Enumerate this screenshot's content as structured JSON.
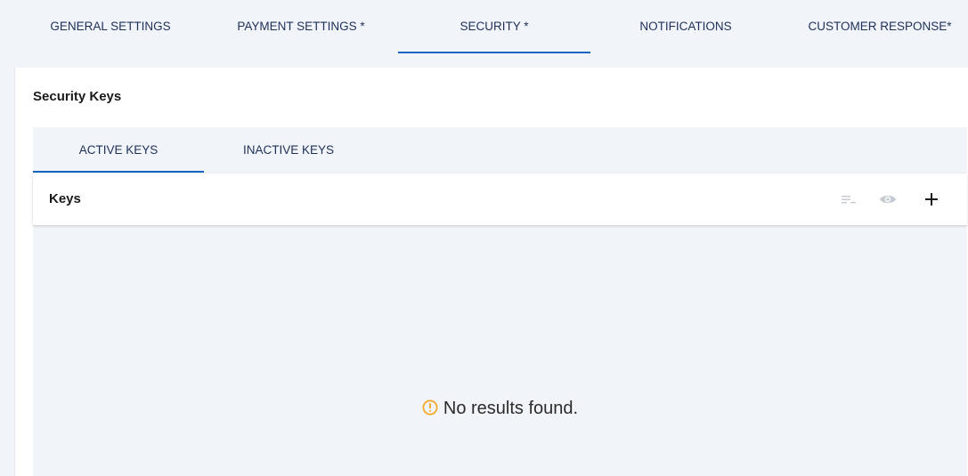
{
  "top_tabs": [
    {
      "label": "GENERAL SETTINGS"
    },
    {
      "label": "PAYMENT SETTINGS *"
    },
    {
      "label": "SECURITY *"
    },
    {
      "label": "NOTIFICATIONS"
    },
    {
      "label": "CUSTOMER RESPONSE*"
    }
  ],
  "active_top_tab": "SECURITY *",
  "panel": {
    "title": "Security Keys",
    "sub_tabs": [
      {
        "label": "ACTIVE KEYS"
      },
      {
        "label": "INACTIVE KEYS"
      }
    ],
    "active_sub_tab": "ACTIVE KEYS",
    "keys_bar": {
      "title": "Keys",
      "icons": [
        "filter-list-icon",
        "eye-icon",
        "plus-icon"
      ]
    },
    "empty_message": "No results found."
  },
  "colors": {
    "accent": "#1565c0",
    "tab_text": "#1e2f5a",
    "background": "#f1f4f8",
    "warning": "#f5a623",
    "disabled_icon": "#c5c9d0"
  }
}
